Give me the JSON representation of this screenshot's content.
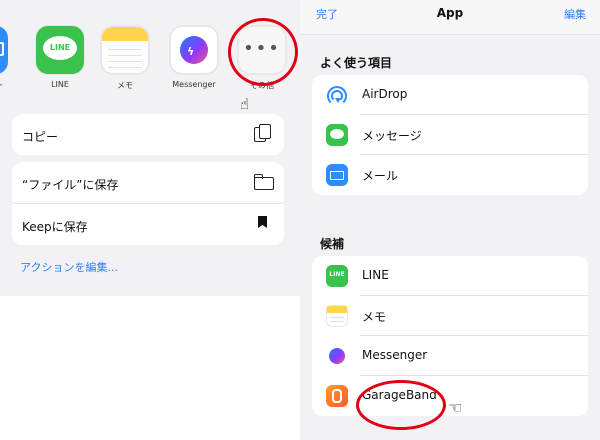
{
  "left": {
    "partial_app_label": "ー",
    "apps": [
      {
        "label": "LINE",
        "icon": "line-app-icon",
        "tile_text": "LINE"
      },
      {
        "label": "メモ",
        "icon": "notes-app-icon"
      },
      {
        "label": "Messenger",
        "icon": "messenger-app-icon"
      },
      {
        "label": "その他",
        "icon": "more-icon"
      }
    ],
    "actions_group1": [
      {
        "label": "コピー",
        "icon": "copy-icon"
      }
    ],
    "actions_group2": [
      {
        "label": "“ファイル”に保存",
        "icon": "folder-icon"
      },
      {
        "label": "Keepに保存",
        "icon": "bookmark-icon"
      }
    ],
    "edit_actions_link": "アクションを編集..."
  },
  "right": {
    "nav": {
      "done": "完了",
      "title": "App",
      "edit": "編集"
    },
    "favorites_title": "よく使う項目",
    "favorites": [
      {
        "label": "AirDrop",
        "icon": "airdrop-icon"
      },
      {
        "label": "メッセージ",
        "icon": "messages-icon"
      },
      {
        "label": "メール",
        "icon": "mail-icon"
      }
    ],
    "suggestions_title": "候補",
    "suggestions": [
      {
        "label": "LINE",
        "icon": "line-app-icon",
        "icon_text": "LINE"
      },
      {
        "label": "メモ",
        "icon": "notes-app-icon"
      },
      {
        "label": "Messenger",
        "icon": "messenger-app-icon"
      },
      {
        "label": "GarageBand",
        "icon": "garageband-icon"
      }
    ]
  },
  "colors": {
    "accent": "#2f7cf6",
    "highlight": "#e00012",
    "line_green": "#3ac34c"
  }
}
